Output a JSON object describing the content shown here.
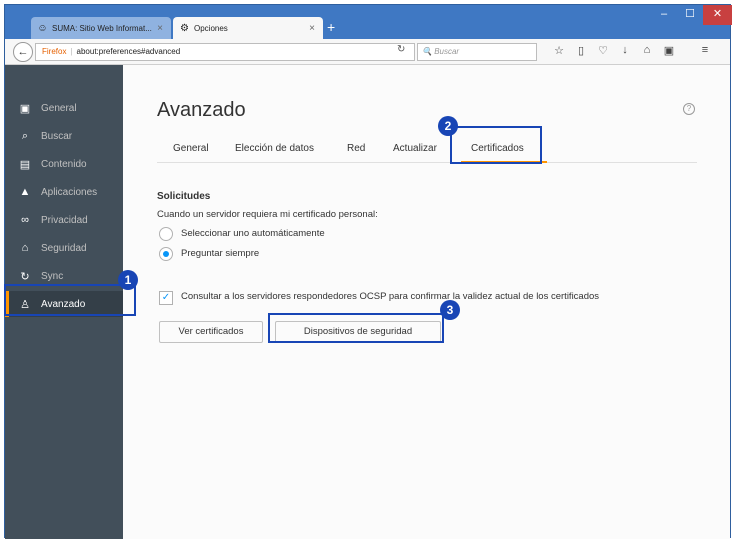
{
  "browser": {
    "tabs": [
      {
        "title": "SUMA: Sitio Web Informat...",
        "icon": "site-favicon"
      },
      {
        "title": "Opciones",
        "icon": "gear-icon"
      }
    ],
    "url_identity": "Firefox",
    "url": "about:preferences#advanced",
    "search_placeholder": "Buscar"
  },
  "sidebar": {
    "items": [
      {
        "label": "General",
        "icon": "general-icon"
      },
      {
        "label": "Buscar",
        "icon": "search-icon"
      },
      {
        "label": "Contenido",
        "icon": "content-icon"
      },
      {
        "label": "Aplicaciones",
        "icon": "applications-icon"
      },
      {
        "label": "Privacidad",
        "icon": "privacy-mask-icon"
      },
      {
        "label": "Seguridad",
        "icon": "lock-icon"
      },
      {
        "label": "Sync",
        "icon": "sync-icon"
      },
      {
        "label": "Avanzado",
        "icon": "advanced-wizard-icon"
      }
    ],
    "selected": "Avanzado"
  },
  "main": {
    "title": "Avanzado",
    "tabs": [
      "General",
      "Elección de datos",
      "Red",
      "Actualizar",
      "Certificados"
    ],
    "active_tab": "Certificados",
    "section_title": "Solicitudes",
    "section_desc": "Cuando un servidor requiera mi certificado personal:",
    "radio_options": [
      {
        "label": "Seleccionar uno automáticamente",
        "checked": false
      },
      {
        "label": "Preguntar siempre",
        "checked": true
      }
    ],
    "ocsp_checkbox": {
      "label": "Consultar a los servidores respondedores OCSP para confirmar la validez actual de los certificados",
      "checked": true
    },
    "buttons": {
      "view_certs": "Ver certificados",
      "security_devices": "Dispositivos de seguridad"
    }
  },
  "callouts": [
    "1",
    "2",
    "3"
  ],
  "colors": {
    "accent": "#ff9500",
    "callout": "#1845b5",
    "sidebar": "#424f5a"
  }
}
